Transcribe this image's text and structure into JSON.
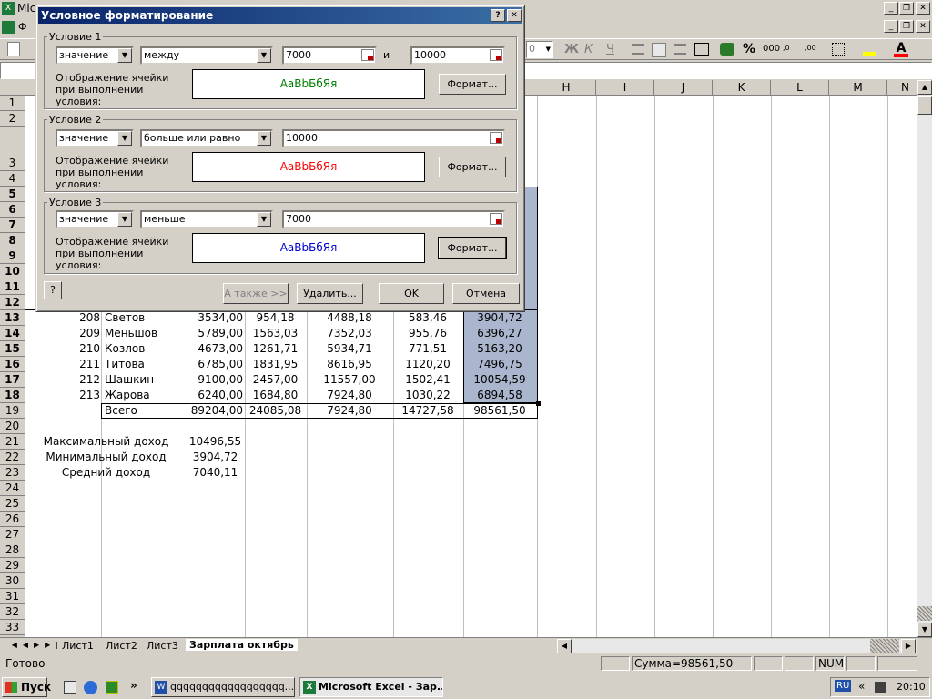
{
  "window": {
    "title_partial": "Mic",
    "menu_partial": "Ф"
  },
  "toolbar": {
    "font_size_partial": "0",
    "bold": "Ж",
    "italic": "К",
    "underline": "Ч",
    "percent": "%",
    "thousands": "000"
  },
  "columns": [
    "H",
    "I",
    "J",
    "K",
    "L",
    "M",
    "N"
  ],
  "rows": [
    "1",
    "2",
    "3",
    "4",
    "5",
    "6",
    "7",
    "8",
    "9",
    "10",
    "11",
    "12",
    "13",
    "14",
    "15",
    "16",
    "17",
    "18",
    "19",
    "20",
    "21",
    "22",
    "23",
    "24",
    "25",
    "26",
    "27",
    "28",
    "29",
    "30",
    "31",
    "32",
    "33"
  ],
  "table": [
    {
      "id": "208",
      "name": "Светов",
      "a": "3534,00",
      "b": "954,18",
      "c": "4488,18",
      "d": "583,46",
      "e": "3904,72"
    },
    {
      "id": "209",
      "name": "Меньшов",
      "a": "5789,00",
      "b": "1563,03",
      "c": "7352,03",
      "d": "955,76",
      "e": "6396,27"
    },
    {
      "id": "210",
      "name": "Козлов",
      "a": "4673,00",
      "b": "1261,71",
      "c": "5934,71",
      "d": "771,51",
      "e": "5163,20"
    },
    {
      "id": "211",
      "name": "Титова",
      "a": "6785,00",
      "b": "1831,95",
      "c": "8616,95",
      "d": "1120,20",
      "e": "7496,75"
    },
    {
      "id": "212",
      "name": "Шашкин",
      "a": "9100,00",
      "b": "2457,00",
      "c": "11557,00",
      "d": "1502,41",
      "e": "10054,59"
    },
    {
      "id": "213",
      "name": "Жарова",
      "a": "6240,00",
      "b": "1684,80",
      "c": "7924,80",
      "d": "1030,22",
      "e": "6894,58"
    }
  ],
  "total": {
    "name": "Всего",
    "a": "89204,00",
    "b": "24085,08",
    "c": "7924,80",
    "d": "14727,58",
    "e": "98561,50"
  },
  "stats": [
    {
      "label": "Максимальный доход",
      "value": "10496,55"
    },
    {
      "label": "Минимальный доход",
      "value": "3904,72"
    },
    {
      "label": "Средний доход",
      "value": "7040,11"
    }
  ],
  "sheets": [
    "Лист1",
    "Лист2",
    "Лист3",
    "Зарплата октябрь"
  ],
  "status": {
    "ready": "Готово",
    "sum": "Сумма=98561,50",
    "num": "NUM"
  },
  "dialog": {
    "title": "Условное форматирование",
    "help_q": "?",
    "and_label": "и",
    "preview_label": "Отображение ячейки при выполнении условия:",
    "format_button": "Формат...",
    "conditions": [
      {
        "title": "Условие 1",
        "type": "значение",
        "op": "между",
        "v1": "7000",
        "v2": "10000",
        "preview": "AaBbБбЯя",
        "color": "#008000"
      },
      {
        "title": "Условие 2",
        "type": "значение",
        "op": "больше или равно",
        "v1": "10000",
        "preview": "AaBbБбЯя",
        "color": "#ff0000"
      },
      {
        "title": "Условие 3",
        "type": "значение",
        "op": "меньше",
        "v1": "7000",
        "preview": "AaBbБбЯя",
        "color": "#0000cc"
      }
    ],
    "also_button": "А также >>",
    "delete_button": "Удалить...",
    "ok_button": "OK",
    "cancel_button": "Отмена"
  },
  "taskbar": {
    "start": "Пуск",
    "task_word": "qqqqqqqqqqqqqqqqqq...",
    "task_excel": "Microsoft Excel - Зар...",
    "lang": "RU",
    "clock": "20:10"
  }
}
